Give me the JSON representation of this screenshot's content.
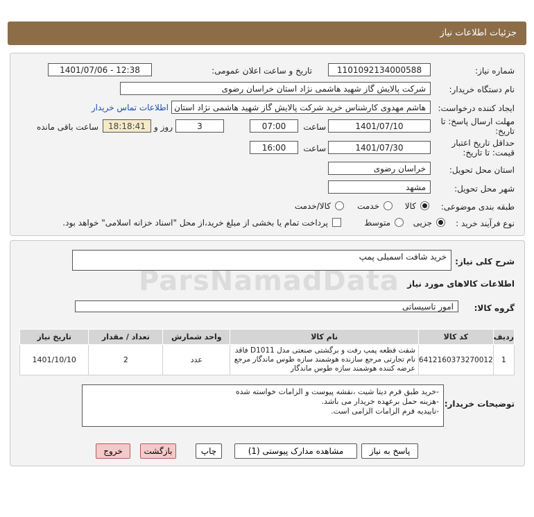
{
  "header": {
    "title": "جزئیات اطلاعات نیاز"
  },
  "form": {
    "need_number_label": "شماره نیاز:",
    "need_number": "1101092134000588",
    "announce_label": "تاریخ و ساعت اعلان عمومی:",
    "announce_value": "1401/07/06 - 12:38",
    "buyer_org_label": "نام دستگاه خریدار:",
    "buyer_org": "شرکت پالایش گاز شهید هاشمی نژاد   استان خراسان رضوی",
    "creator_label": "ایجاد کننده درخواست:",
    "creator": "هاشم مهدوی کارشناس خرید شرکت پالایش گاز شهید هاشمی نژاد   استان خراسان رضوی",
    "contact_link": "اطلاعات تماس خریدار",
    "reply_deadline_label": "مهلت ارسال پاسخ: تا",
    "reply_deadline_label2": "تاریخ:",
    "reply_date": "1401/07/10",
    "time_label": "ساعت",
    "reply_time": "07:00",
    "days_value": "3",
    "days_label": "روز و",
    "remaining_time": "18:18:41",
    "remaining_label": "ساعت باقی مانده",
    "validity_label": "حداقل تاریخ اعتبار",
    "validity_label2": "قیمت: تا تاریخ:",
    "validity_date": "1401/07/30",
    "validity_time_label": "ساعت",
    "validity_time": "16:00",
    "province_label": "استان محل تحویل:",
    "province": "خراسان رضوی",
    "city_label": "شهر محل تحویل:",
    "city": "مشهد",
    "category_label": "طبقه بندی موضوعی:",
    "category_options": [
      "کالا",
      "خدمت",
      "کالا/خدمت"
    ],
    "process_label": "نوع فرآیند خرید :",
    "process_options": [
      "جزیی",
      "متوسط"
    ],
    "payment_note": "پرداخت تمام یا بخشی از مبلغ خرید،از محل \"اسناد خزانه اسلامی\" خواهد بود."
  },
  "summary": {
    "label": "شرح کلی نیاز:",
    "value": "خرید شافت اسمبلی پمپ"
  },
  "goods": {
    "section_title": "اطلاعات کالاهای مورد نیاز",
    "group_label": "گروه کالا:",
    "group_value": "امور تاسیساتی",
    "columns": [
      "ردیف",
      "کد کالا",
      "نام کالا",
      "واحد شمارش",
      "تعداد / مقدار",
      "تاریخ نیاز"
    ],
    "rows": [
      {
        "row": "1",
        "code": "6412160373270012",
        "name": "شفت قطعه پمپ رفت و برگشتی صنعتی مدل D1011 فاقد نام تجارتی مرجع سازنده هوشمند سازه طوس ماندگار مرجع عرضه کننده هوشمند سازه طوس ماندگار",
        "unit": "عدد",
        "qty": "2",
        "date": "1401/10/10"
      }
    ]
  },
  "buyer_notes": {
    "label": "توضیحات خریدار:",
    "lines": [
      "-خرید طبق فرم دیتا شیت ،نقشه پیوست و الزامات خواسته شده",
      "-هزینه حمل برعهده خریدار می باشد.",
      "-تاییدیه فرم الزامات الزامی است."
    ]
  },
  "buttons": {
    "reply": "پاسخ به نیاز",
    "attachments": "مشاهده مدارک پیوستی (1)",
    "print": "چاپ",
    "back": "بازگشت",
    "exit": "خروج"
  },
  "watermark": "ParsNamadData",
  "colors": {
    "header": "#8c6d48",
    "link": "#1a4fb5",
    "highlight": "#f4eac8"
  }
}
